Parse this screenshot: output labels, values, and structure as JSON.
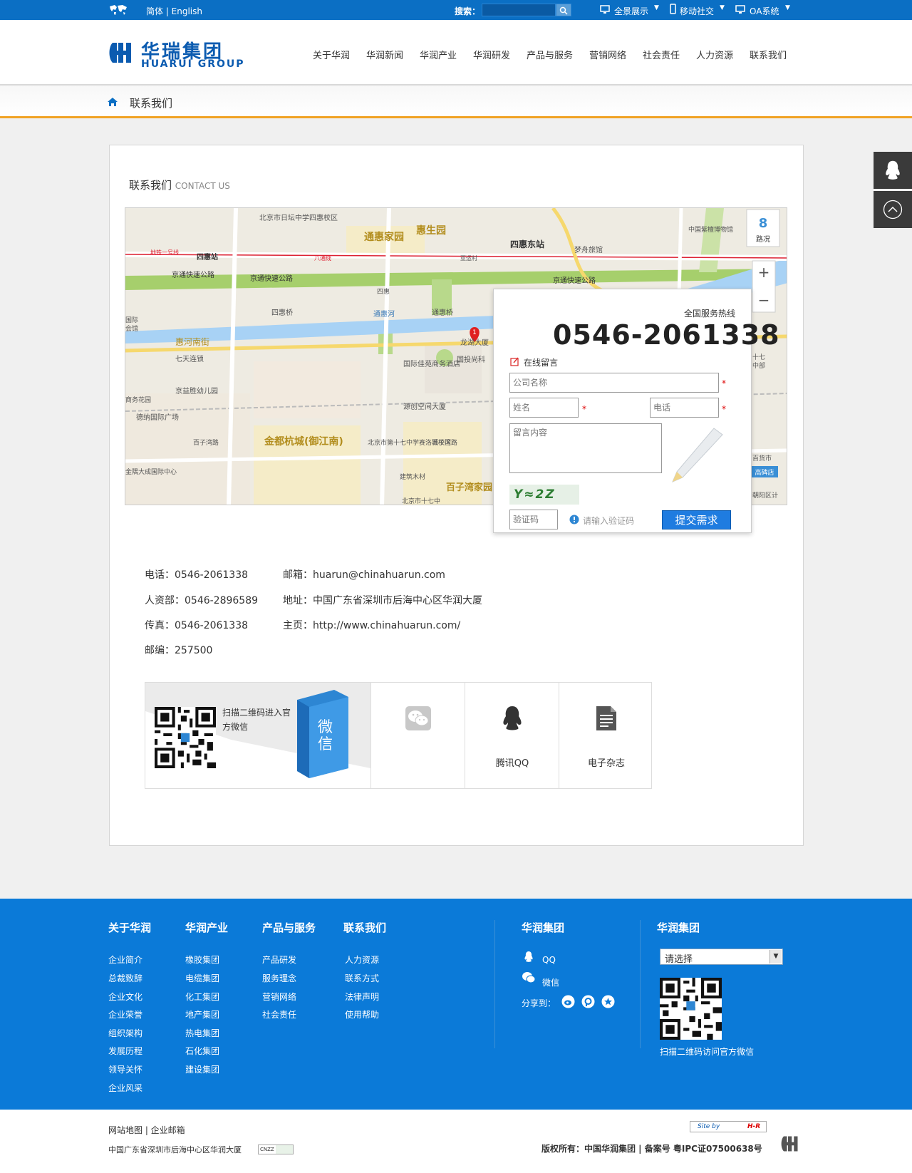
{
  "topbar": {
    "lang": "简体 | English",
    "search_label": "搜索：",
    "search_placeholder": "",
    "links": [
      "全景展示",
      "移动社交",
      "OA系统"
    ]
  },
  "header": {
    "logo_cn": "华瑞集团",
    "logo_en": "HUARUI GROUP",
    "nav": [
      "关于华润",
      "华润新闻",
      "华润产业",
      "华润研发",
      "产品与服务",
      "营销网络",
      "社会责任",
      "人力资源",
      "联系我们"
    ]
  },
  "breadcrumb": {
    "current": "联系我们"
  },
  "main": {
    "title_cn": "联系我们",
    "title_en": "CONTACT US"
  },
  "map": {
    "labels": [
      "北京市日坛中学四惠校区",
      "通惠家园",
      "惠生园",
      "四惠东站",
      "梦舟旅馆",
      "四惠站",
      "地铁一号线",
      "八通线",
      "亚运村",
      "京通快速公路",
      "京通快速公路",
      "京通快速公路",
      "四惠",
      "四惠桥",
      "通惠河",
      "通惠桥",
      "惠河南街",
      "七天连锁",
      "国际佳苑商务酒店",
      "国投尚科",
      "龙湖大厦",
      "源创空间大厦",
      "京益胜幼儿园",
      "德纳国际广场",
      "百子湾路",
      "金都杭城(御江南)",
      "北京市第十七中学赛洛城校区",
      "百子湾路",
      "百子湾家园",
      "建筑木材",
      "北京市十七中",
      "商务花园",
      "金隅大成国际中心",
      "中国紫檀博物馆",
      "路况",
      "国际",
      "会馆",
      "十七",
      "中部",
      "高碑店",
      "百货市",
      "朝阳区计"
    ],
    "zoom_in": "+",
    "zoom_out": "−",
    "marker": "1"
  },
  "form": {
    "hotline_label": "全国服务热线",
    "hotline": "0546-2061338",
    "online_label": "在线留言",
    "company_placeholder": "公司名称",
    "name_placeholder": "姓名",
    "phone_placeholder": "电话",
    "message_placeholder": "留言内容",
    "captcha_text": "Y≈2Z",
    "captcha_placeholder": "验证码",
    "captcha_hint": "请输入验证码",
    "submit": "提交需求",
    "required_mark": "*"
  },
  "contact": {
    "phone": "电话：0546-2061338",
    "hr": "人资部：0546-2896589",
    "fax": "传真：0546-2061338",
    "zip": "邮编：257500",
    "email": "邮箱：huarun@chinahuarun.com",
    "address": "地址：中国广东省深圳市后海中心区华润大厦",
    "homepage": "主页：http://www.chinahuarun.com/"
  },
  "social": {
    "scan_text": "扫描二维码进入官方微信",
    "weixin": "微信",
    "qq": "腾讯QQ",
    "magazine": "电子杂志"
  },
  "footer": {
    "col1": {
      "title": "关于华润",
      "items": [
        "企业简介",
        "总裁致辞",
        "企业文化",
        "企业荣誉",
        "组织架构",
        "发展历程",
        "领导关怀",
        "企业风采"
      ]
    },
    "col2": {
      "title": "华润产业",
      "items": [
        "橡胶集团",
        "电缆集团",
        "化工集团",
        "地产集团",
        "热电集团",
        "石化集团",
        "建设集团"
      ]
    },
    "col3": {
      "title": "产品与服务",
      "items": [
        "产品研发",
        "服务理念",
        "营销网络",
        "社会责任"
      ]
    },
    "col4": {
      "title": "联系我们",
      "items": [
        "人力资源",
        "联系方式",
        "法律声明",
        "使用帮助"
      ]
    },
    "group1": {
      "title": "华润集团",
      "qq": "QQ",
      "weixin": "微信",
      "share": "分享到："
    },
    "group2": {
      "title": "华润集团",
      "select": "请选择",
      "qr_caption": "扫描二维码访问官方微信"
    }
  },
  "bottom": {
    "links": "网站地图 | 企业邮箱",
    "address": "中国广东省深圳市后海中心区华润大厦",
    "cnzz": "CNZZ",
    "site_by": "Site by",
    "hr": "H-R",
    "copyright": "版权所有：中国华润集团 | 备案号 粤IPC证07500638号"
  },
  "colors": {
    "brand_blue": "#0b6fc4",
    "accent_orange": "#f1a325",
    "footer_blue": "#0b7ad8"
  }
}
